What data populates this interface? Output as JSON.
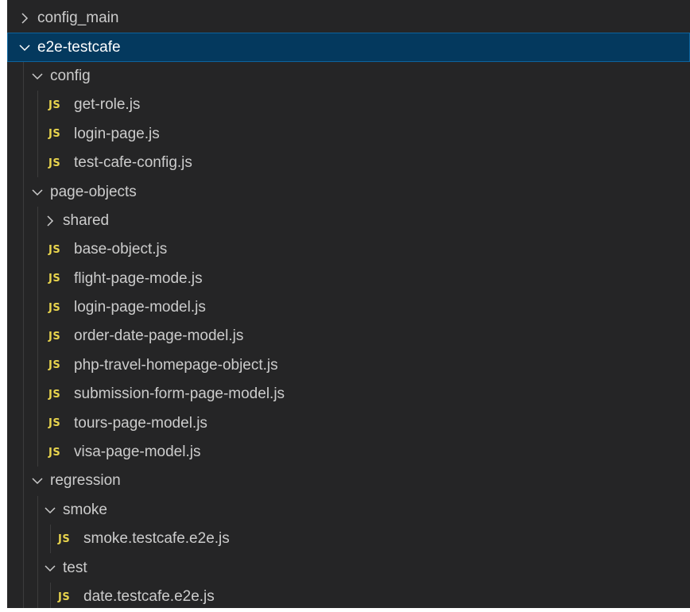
{
  "tree": {
    "config_main": {
      "label": "config_main",
      "icon": "chevron-right-icon"
    },
    "e2e_testcafe": {
      "label": "e2e-testcafe",
      "icon": "chevron-down-icon"
    },
    "config": {
      "label": "config",
      "icon": "chevron-down-icon",
      "files": [
        "get-role.js",
        "login-page.js",
        "test-cafe-config.js"
      ]
    },
    "page_objects": {
      "label": "page-objects",
      "icon": "chevron-down-icon",
      "shared": {
        "label": "shared",
        "icon": "chevron-right-icon"
      },
      "files": [
        "base-object.js",
        "flight-page-mode.js",
        "login-page-model.js",
        "order-date-page-model.js",
        "php-travel-homepage-object.js",
        "submission-form-page-model.js",
        "tours-page-model.js",
        "visa-page-model.js"
      ]
    },
    "regression": {
      "label": "regression",
      "icon": "chevron-down-icon",
      "smoke": {
        "label": "smoke",
        "icon": "chevron-down-icon",
        "files": [
          "smoke.testcafe.e2e.js"
        ]
      },
      "test": {
        "label": "test",
        "icon": "chevron-down-icon",
        "files": [
          "date.testcafe.e2e.js"
        ]
      }
    }
  },
  "file_badge": "JS",
  "colors": {
    "background": "#252526",
    "selected_row": "#04395e",
    "selected_outline": "#0e639c",
    "text": "#cccccc",
    "js_badge": "#e8d44d"
  }
}
